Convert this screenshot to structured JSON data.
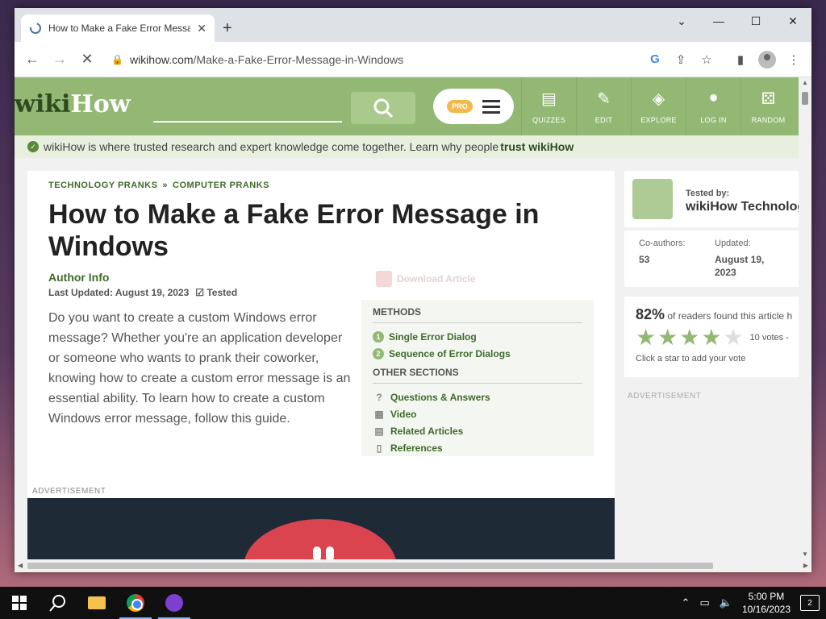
{
  "browser": {
    "tab_title": "How to Make a Fake Error Messa",
    "tab_close": "✕",
    "new_tab": "+",
    "url_domain": "wikihow.com",
    "url_path": "/Make-a-Fake-Error-Message-in-Windows"
  },
  "wikihow": {
    "logo_wiki": "wiki",
    "logo_how": "How",
    "pro_badge": "PRO",
    "nav": [
      {
        "label": "QUIZZES",
        "icon": "quiz-icon"
      },
      {
        "label": "EDIT",
        "icon": "pencil-icon"
      },
      {
        "label": "EXPLORE",
        "icon": "compass-icon"
      },
      {
        "label": "LOG IN",
        "icon": "user-icon"
      },
      {
        "label": "RANDOM",
        "icon": "dice-icon"
      }
    ],
    "trust_text": "wikiHow is where trusted research and expert knowledge come together. Learn why people ",
    "trust_link": "trust wikiHow"
  },
  "article": {
    "breadcrumb": [
      "TECHNOLOGY PRANKS",
      "COMPUTER PRANKS"
    ],
    "breadcrumb_sep": "»",
    "title": "How to Make a Fake Error Message in Windows",
    "author_info": "Author Info",
    "last_updated": "Last Updated: August 19, 2023",
    "tested": "Tested",
    "download": "Download Article",
    "intro": "Do you want to create a custom Windows error message? Whether you're an application developer or someone who wants to prank their coworker, knowing how to create a custom error message is an essential ability. To learn how to create a custom Windows error message, follow this guide.",
    "methods_heading": "METHODS",
    "methods": [
      {
        "num": "1",
        "label": "Single Error Dialog"
      },
      {
        "num": "2",
        "label": "Sequence of Error Dialogs"
      }
    ],
    "other_heading": "OTHER SECTIONS",
    "other": [
      {
        "label": "Questions & Answers",
        "icon": "question-icon"
      },
      {
        "label": "Video",
        "icon": "video-icon"
      },
      {
        "label": "Related Articles",
        "icon": "articles-icon"
      },
      {
        "label": "References",
        "icon": "references-icon"
      }
    ],
    "advertisement": "ADVERTISEMENT"
  },
  "sidebar": {
    "tested_by": "Tested by:",
    "tester_name": "wikiHow Technolog",
    "coauthors_label": "Co-authors:",
    "coauthors_value": "53",
    "updated_label": "Updated:",
    "updated_value": "August 19, 2023",
    "rating_pct": "82%",
    "rating_text": " of readers found this article h",
    "stars_filled": 4,
    "stars_total": 5,
    "votes": "10 votes -",
    "star_hint": "Click a star to add your vote",
    "advertisement": "ADVERTISEMENT"
  },
  "taskbar": {
    "time": "5:00 PM",
    "date": "10/16/2023",
    "notifications": "2"
  }
}
